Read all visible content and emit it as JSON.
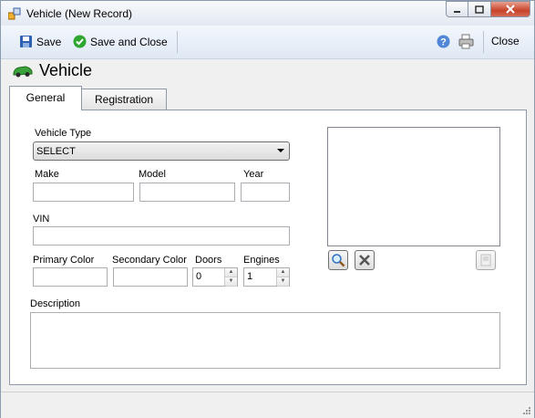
{
  "window": {
    "title": "Vehicle (New Record)"
  },
  "toolbar": {
    "save_label": "Save",
    "save_close_label": "Save and Close",
    "close_label": "Close"
  },
  "header": {
    "title": "Vehicle"
  },
  "tabs": [
    {
      "label": "General"
    },
    {
      "label": "Registration"
    }
  ],
  "form": {
    "vehicle_type_label": "Vehicle Type",
    "vehicle_type_value": "SELECT",
    "make_label": "Make",
    "model_label": "Model",
    "year_label": "Year",
    "vin_label": "VIN",
    "primary_color_label": "Primary Color",
    "secondary_color_label": "Secondary Color",
    "doors_label": "Doors",
    "doors_value": "0",
    "engines_label": "Engines",
    "engines_value": "1",
    "description_label": "Description"
  },
  "colors": {
    "accent": "#2e6fc0",
    "close_button": "#c7432a",
    "car_icon": "#3aa23a"
  }
}
